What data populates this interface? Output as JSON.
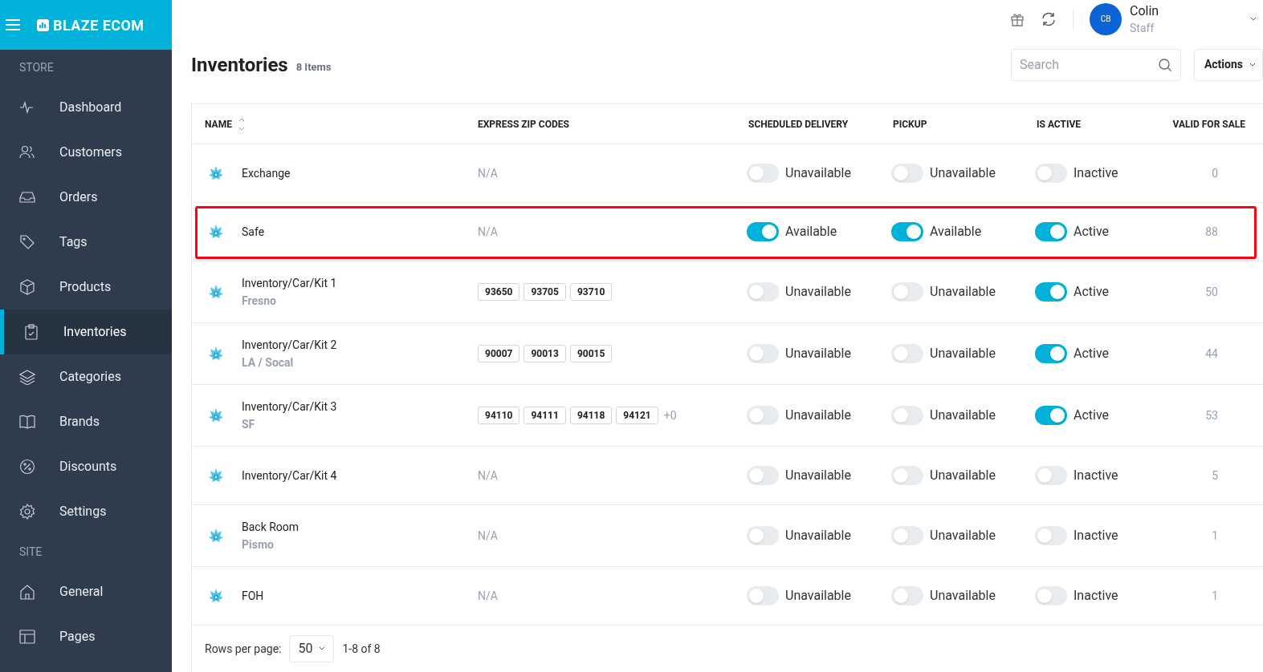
{
  "brand": {
    "name": "BLAZE ECOM"
  },
  "sidebar": {
    "sections": [
      {
        "title": "STORE",
        "items": [
          {
            "label": "Dashboard",
            "selected": false
          },
          {
            "label": "Customers",
            "selected": false
          },
          {
            "label": "Orders",
            "selected": false
          },
          {
            "label": "Tags",
            "selected": false
          },
          {
            "label": "Products",
            "selected": false
          },
          {
            "label": "Inventories",
            "selected": true
          },
          {
            "label": "Categories",
            "selected": false
          },
          {
            "label": "Brands",
            "selected": false
          },
          {
            "label": "Discounts",
            "selected": false
          },
          {
            "label": "Settings",
            "selected": false
          }
        ]
      },
      {
        "title": "SITE",
        "items": [
          {
            "label": "General",
            "selected": false
          },
          {
            "label": "Pages",
            "selected": false
          }
        ]
      }
    ]
  },
  "user": {
    "initials": "CB",
    "name": "Colin",
    "role": "Staff"
  },
  "page": {
    "title": "Inventories",
    "count": "8 Items",
    "search_placeholder": "Search",
    "actions_label": "Actions"
  },
  "table": {
    "columns": [
      "NAME",
      "EXPRESS ZIP CODES",
      "SCHEDULED DELIVERY",
      "PICKUP",
      "IS ACTIVE",
      "VALID FOR SALE"
    ],
    "rows": [
      {
        "name": "Exchange",
        "zips": [],
        "zip_empty": "N/A",
        "scheduled": {
          "on": false,
          "label": "Unavailable"
        },
        "pickup": {
          "on": false,
          "label": "Unavailable"
        },
        "active": {
          "on": false,
          "label": "Inactive"
        },
        "valid": "0",
        "highlighted": false
      },
      {
        "name": "Safe",
        "zips": [],
        "zip_empty": "N/A",
        "scheduled": {
          "on": true,
          "label": "Available"
        },
        "pickup": {
          "on": true,
          "label": "Available"
        },
        "active": {
          "on": true,
          "label": "Active"
        },
        "valid": "88",
        "highlighted": true
      },
      {
        "name": "Inventory/Car/Kit 1",
        "subtitle": "Fresno",
        "zips": [
          "93650",
          "93705",
          "93710"
        ],
        "scheduled": {
          "on": false,
          "label": "Unavailable"
        },
        "pickup": {
          "on": false,
          "label": "Unavailable"
        },
        "active": {
          "on": true,
          "label": "Active"
        },
        "valid": "50",
        "highlighted": false
      },
      {
        "name": "Inventory/Car/Kit 2",
        "subtitle": "LA / Socal",
        "zips": [
          "90007",
          "90013",
          "90015"
        ],
        "scheduled": {
          "on": false,
          "label": "Unavailable"
        },
        "pickup": {
          "on": false,
          "label": "Unavailable"
        },
        "active": {
          "on": true,
          "label": "Active"
        },
        "valid": "44",
        "highlighted": false
      },
      {
        "name": "Inventory/Car/Kit 3",
        "subtitle": "SF",
        "zips": [
          "94110",
          "94111",
          "94118",
          "94121"
        ],
        "zip_more": "+0",
        "scheduled": {
          "on": false,
          "label": "Unavailable"
        },
        "pickup": {
          "on": false,
          "label": "Unavailable"
        },
        "active": {
          "on": true,
          "label": "Active"
        },
        "valid": "53",
        "highlighted": false
      },
      {
        "name": "Inventory/Car/Kit 4",
        "zips": [],
        "zip_empty": "N/A",
        "scheduled": {
          "on": false,
          "label": "Unavailable"
        },
        "pickup": {
          "on": false,
          "label": "Unavailable"
        },
        "active": {
          "on": false,
          "label": "Inactive"
        },
        "valid": "5",
        "highlighted": false
      },
      {
        "name": "Back Room",
        "subtitle": "Pismo",
        "zips": [],
        "zip_empty": "N/A",
        "scheduled": {
          "on": false,
          "label": "Unavailable"
        },
        "pickup": {
          "on": false,
          "label": "Unavailable"
        },
        "active": {
          "on": false,
          "label": "Inactive"
        },
        "valid": "1",
        "highlighted": false
      },
      {
        "name": "FOH",
        "zips": [],
        "zip_empty": "N/A",
        "scheduled": {
          "on": false,
          "label": "Unavailable"
        },
        "pickup": {
          "on": false,
          "label": "Unavailable"
        },
        "active": {
          "on": false,
          "label": "Inactive"
        },
        "valid": "1",
        "highlighted": false
      }
    ]
  },
  "pagination": {
    "label": "Rows per page:",
    "rows_per_page": "50",
    "range": "1-8 of 8"
  }
}
